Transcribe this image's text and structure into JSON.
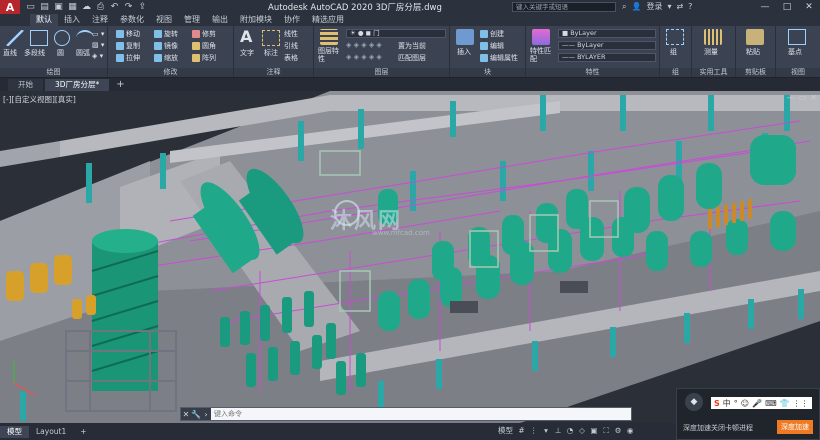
{
  "app": {
    "logo_letter": "A",
    "title": "Autodesk AutoCAD 2020    3D厂房分层.dwg",
    "search_placeholder": "键入关键字或短语",
    "signin": "登录",
    "qat_icons": [
      "new-icon",
      "open-icon",
      "save-icon",
      "saveas-icon",
      "cloud-icon",
      "print-icon",
      "undo-icon",
      "redo-icon",
      "share-icon"
    ]
  },
  "ribbon_tabs": [
    "默认",
    "插入",
    "注释",
    "参数化",
    "视图",
    "管理",
    "输出",
    "附加模块",
    "协作",
    "精选应用"
  ],
  "ribbon": {
    "draw": {
      "title": "绘图",
      "tools": [
        "直线",
        "多段线",
        "圆",
        "圆弧"
      ]
    },
    "modify": {
      "title": "修改",
      "rows": [
        [
          "移动",
          "旋转",
          "修剪"
        ],
        [
          "复制",
          "镜像",
          "圆角"
        ],
        [
          "拉伸",
          "缩放",
          "阵列"
        ]
      ]
    },
    "annotation": {
      "title": "注释",
      "tools": [
        "文字",
        "标注"
      ],
      "side": [
        "线性",
        "引线",
        "表格"
      ]
    },
    "layers": {
      "title": "图层",
      "tools": [
        "图层特性"
      ],
      "side": [
        "置为当前",
        "匹配图层"
      ],
      "layer_value": "门"
    },
    "block": {
      "title": "块",
      "tools": [
        "插入"
      ],
      "side": [
        "创建",
        "编辑",
        "编辑属性"
      ]
    },
    "properties": {
      "title": "特性",
      "tools": [
        "特性匹配"
      ],
      "bylayer_1": "ByLayer",
      "bylayer_2": "ByLayer",
      "bylayer_3": "BYLAYER"
    },
    "groups": {
      "title": "组",
      "tools": [
        "组"
      ]
    },
    "utilities": {
      "title": "实用工具",
      "tools": [
        "测量"
      ]
    },
    "clipboard": {
      "title": "剪贴板",
      "tools": [
        "粘贴"
      ]
    },
    "view": {
      "title": "视图",
      "tools": [
        "基点"
      ]
    }
  },
  "file_tabs": {
    "start": "开始",
    "drawing": "3D厂房分层*"
  },
  "viewport": {
    "label": "[-][自定义视图][真实]",
    "watermark": "沐风网",
    "watermark_url": "www.mfcad.com"
  },
  "command": {
    "placeholder": "键入命令"
  },
  "status": {
    "tabs": [
      "模型",
      "Layout1"
    ],
    "model_label": "模型"
  },
  "overlay": {
    "ime_items": [
      "S",
      "中",
      "°",
      "☺",
      "🎤",
      "⌨",
      "👕",
      "⋮⋮"
    ],
    "text": "深度加速关闭卡顿进程",
    "button": "深度加速"
  },
  "colors": {
    "teal_equipment": "#1fa88a",
    "column": "#2aa7a7",
    "pipe": "#c84bd6",
    "wall": "#a9aab0",
    "tank_gold": "#d7a02a"
  }
}
